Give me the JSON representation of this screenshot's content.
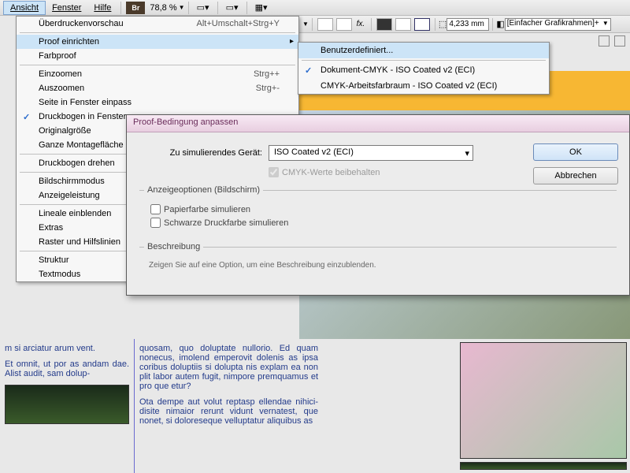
{
  "menubar": {
    "ansicht": "Ansicht",
    "fenster": "Fenster",
    "hilfe": "Hilfe",
    "br_badge": "Br",
    "zoom": "78,8 %"
  },
  "toolbar": {
    "size_value": "4,233 mm",
    "frame_combo": "[Einfacher Grafikrahmen]+"
  },
  "view_menu": {
    "overprint": "Überdruckenvorschau",
    "overprint_sc": "Alt+Umschalt+Strg+Y",
    "proof_setup": "Proof einrichten",
    "farbproof": "Farbproof",
    "zoom_in": "Einzoomen",
    "zoom_in_sc": "Strg++",
    "zoom_out": "Auszoomen",
    "zoom_out_sc": "Strg+-",
    "fit_page": "Seite in Fenster einpass",
    "fit_spread": "Druckbogen in Fenster",
    "original": "Originalgröße",
    "pasteboard": "Ganze Montagefläche",
    "rotate_spread": "Druckbogen drehen",
    "screen_mode": "Bildschirmmodus",
    "display_perf": "Anzeigeleistung",
    "rulers": "Lineale einblenden",
    "extras": "Extras",
    "grids": "Raster und Hilfslinien",
    "structure": "Struktur",
    "textmode": "Textmodus"
  },
  "submenu": {
    "custom": "Benutzerdefiniert...",
    "doc_cmyk": "Dokument-CMYK - ISO Coated v2 (ECI)",
    "working_cmyk": "CMYK-Arbeitsfarbraum - ISO Coated v2 (ECI)"
  },
  "dialog": {
    "title": "Proof-Bedingung anpassen",
    "device_label": "Zu simulierendes Gerät:",
    "device_value": "ISO Coated v2 (ECI)",
    "preserve_cmyk": "CMYK-Werte beibehalten",
    "display_group": "Anzeigeoptionen (Bildschirm)",
    "paper_color": "Papierfarbe simulieren",
    "black_ink": "Schwarze Druckfarbe simulieren",
    "desc_group": "Beschreibung",
    "desc_text": "Zeigen Sie auf eine Option, um eine Beschreibung einzublenden.",
    "ok": "OK",
    "cancel": "Abbrechen"
  },
  "doc": {
    "col1_p1": "m si arciatur arum vent.",
    "col1_p2": "Et omnit, ut por as andam dae. Alist audit, sam dolup-",
    "col2_p1": "quosam, quo doluptate nullorio. Ed quam nonecus, imolend emperovit dolenis as ipsa coribus doluptiis si dolupta nis explam ea non plit labor autem fugit, nimpore premquamus et pro que etur?",
    "col2_p2": "Ota dempe aut volut reptasp ellendae nihici-disite nimaior rerunt vidunt vernatest, que nonet, si doloreseque velluptatur aliquibus as"
  }
}
